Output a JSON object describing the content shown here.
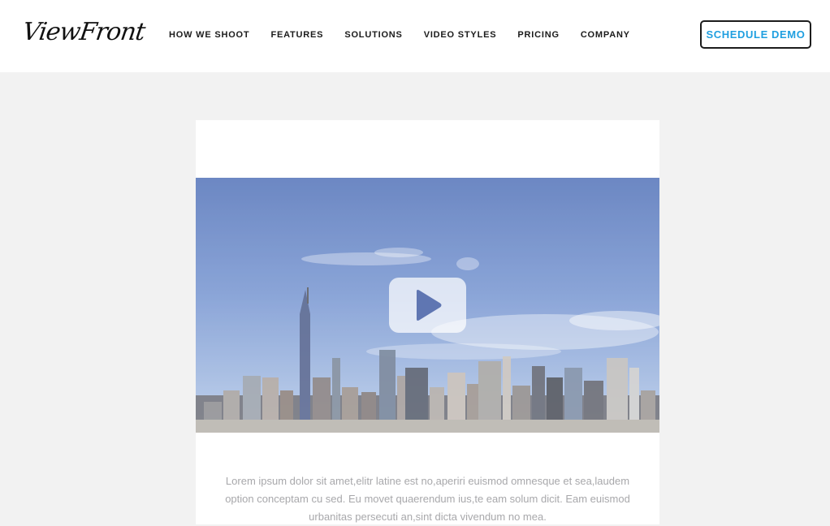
{
  "header": {
    "logo_text": "ViewFront",
    "nav": [
      {
        "label": "HOW WE SHOOT"
      },
      {
        "label": "FEATURES"
      },
      {
        "label": "SOLUTIONS"
      },
      {
        "label": "VIDEO STYLES"
      },
      {
        "label": "PRICING"
      },
      {
        "label": "COMPANY"
      }
    ],
    "cta_label": "SCHEDULE DEMO"
  },
  "video": {
    "thumbnail_icon": "city-skyline-thumbnail",
    "play_icon": "play-icon"
  },
  "content": {
    "description": "Lorem ipsum dolor sit amet,elitr latine est no,aperiri euismod omnesque et sea,laudem option conceptam cu sed. Eu movet quaerendum ius,te eam solum dicit. Eam euismod urbanitas persecuti an,sint dicta vivendum no mea."
  },
  "colors": {
    "accent": "#1f9fe0",
    "page_bg": "#f2f2f2",
    "text_muted": "#a8a8ab"
  }
}
